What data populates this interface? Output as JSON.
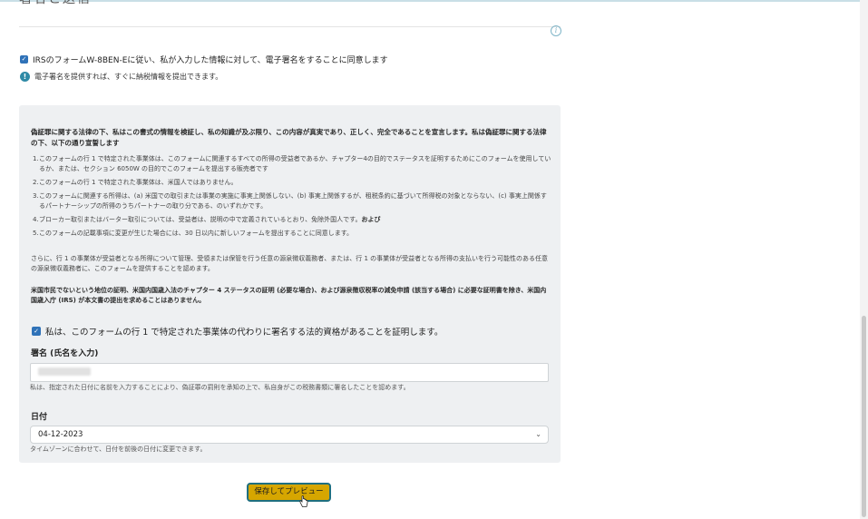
{
  "heading_fragment": "署名と送信",
  "consent": {
    "label": "IRSのフォームW-8BEN-Eに従い、私が入力した情報に対して、電子署名をすることに同意します"
  },
  "note": "電子署名を提供すれば、すぐに納税情報を提出できます。",
  "declaration": {
    "heading": "偽証罪に関する法律の下、私はこの書式の情報を検証し、私の知識が及ぶ限り、この内容が真実であり、正しく、完全であることを宣言します。私は偽証罪に関する法律の下、以下の通り宣誓します",
    "items": [
      {
        "num": "1.",
        "text": "このフォームの行 1 で特定された事業体は、このフォームに関連するすべての所得の受益者であるか、チャプター4の目的でステータスを証明するためにこのフォームを使用しているか、または、セクション 6050W の目的でこのフォームを提出する販売者です"
      },
      {
        "num": "2.",
        "text": "このフォームの行 1 で特定された事業体は、米国人ではありません。"
      },
      {
        "num": "3.",
        "text": "このフォームに関連する所得は、(a) 米国での取引または事業の実施に事実上関係しない、(b) 事実上関係するが、租税条約に基づいて所得税の対象とならない、(c) 事実上関係するパートナーシップの所得のうちパートナーの取り分である、のいずれかです。"
      },
      {
        "num": "4.",
        "text": "ブローカー取引またはバーター取引については、受益者は、説明の中で定義されているとおり、免除外国人です。",
        "bold_suffix": "および"
      },
      {
        "num": "5.",
        "text": "このフォームの記載事項に変更が生じた場合には、30 日以内に新しいフォームを提出することに同意します。"
      }
    ],
    "paragraph": "さらに、行 1 の事業体が受益者となる所得について管理、受領または保管を行う任意の源泉徴収義務者、または、行 1 の事業体が受益者となる所得の支払いを行う可能性のある任意の源泉徴収義務者に、このフォームを提供することを認めます。",
    "bold_paragraph": "米国市民でないという地位の証明、米国内国歳入法のチャプター 4 ステータスの証明 (必要な場合)、および源泉徴収税率の減免申請 (該当する場合) に必要な証明書を除き、米国内国歳入庁 (IRS) が本文書の提出を求めることはありません。"
  },
  "certify": {
    "label": "私は、このフォームの行 1 で特定された事業体の代わりに署名する法的資格があることを証明します。"
  },
  "signature": {
    "label": "署名 (氏名を入力)",
    "help": "私は、指定された日付に名前を入力することにより、偽証罪の罰則を承知の上で、私自身がこの税務書類に署名したことを認めます。"
  },
  "date": {
    "label": "日付",
    "value": "04-12-2023",
    "help": "タイムゾーンに合わせて、日付を前後の日付に変更できます。"
  },
  "save_button": "保存してプレビュー",
  "icons": {
    "checkbox_checked": "check-icon",
    "info": "info-icon",
    "chevron": "chevron-down-icon",
    "cursor": "hand-cursor-icon"
  },
  "colors": {
    "checkbox": "#2f72b8",
    "info": "#2f8aa6",
    "button": "#d6a600",
    "button_border": "#1f6f80",
    "panel": "#eef0f2"
  }
}
